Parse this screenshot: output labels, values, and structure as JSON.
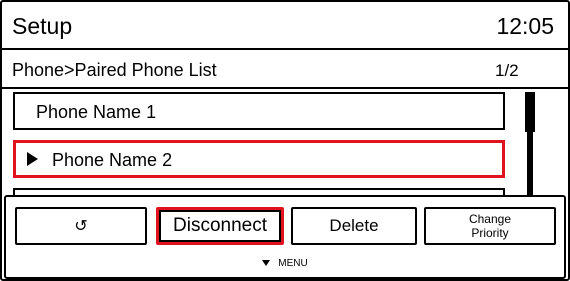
{
  "header": {
    "title": "Setup",
    "time": "12:05"
  },
  "breadcrumb": {
    "path": "Phone>Paired Phone List",
    "page": "1/2"
  },
  "list": {
    "items": [
      {
        "label": "Phone Name 1",
        "selected": false
      },
      {
        "label": "Phone Name 2",
        "selected": true
      }
    ]
  },
  "menu": {
    "back_label": "↺",
    "disconnect_label": "Disconnect",
    "delete_label": "Delete",
    "change_priority_line1": "Change",
    "change_priority_line2": "Priority",
    "hint_label": "MENU"
  },
  "colors": {
    "highlight": "#e0141e",
    "foreground": "#000000",
    "background": "#ffffff"
  },
  "icons": {
    "selection_marker": "play-triangle-icon",
    "back": "back-arrow-icon",
    "menu_hint": "triangle-down-icon"
  }
}
